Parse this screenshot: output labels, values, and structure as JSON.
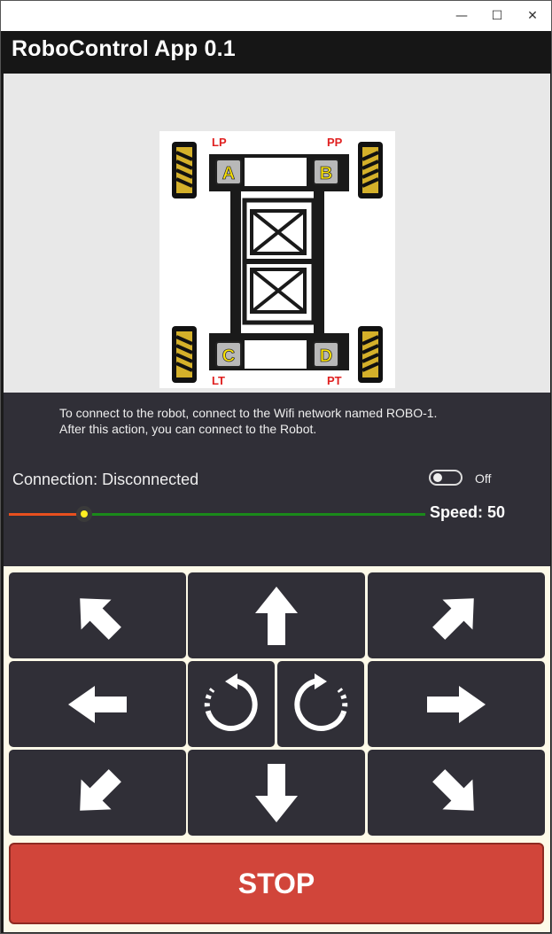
{
  "window": {
    "minimize_glyph": "—",
    "maximize_glyph": "☐",
    "close_glyph": "✕"
  },
  "app": {
    "title": "RoboControl App 0.1"
  },
  "robot_image": {
    "wheel_labels": {
      "front_left": "LP",
      "front_right": "PP",
      "rear_left": "LT",
      "rear_right": "PT"
    },
    "motor_letters": {
      "a": "A",
      "b": "B",
      "c": "C",
      "d": "D"
    }
  },
  "info": {
    "line1": "To connect to the robot, connect to the Wifi network named ROBO-1.",
    "line2": "After this action, you can connect to the Robot."
  },
  "connection": {
    "label": "Connection: Disconnected",
    "toggle_state": "Off",
    "toggle_on": false
  },
  "speed": {
    "label": "Speed: 50",
    "value": 50,
    "fraction": 0.18,
    "colors": {
      "low": "#e8501e",
      "high": "#1a8a1a",
      "thumb": "#ffee22"
    }
  },
  "controls": {
    "buttons": [
      "up-left-arrow",
      "up-arrow",
      "up-right-arrow",
      "left-arrow",
      "rotate-left-icon",
      "rotate-right-icon",
      "right-arrow",
      "down-left-arrow",
      "down-arrow",
      "down-right-arrow"
    ],
    "stop_label": "STOP",
    "stop_color": "#d1453a"
  }
}
